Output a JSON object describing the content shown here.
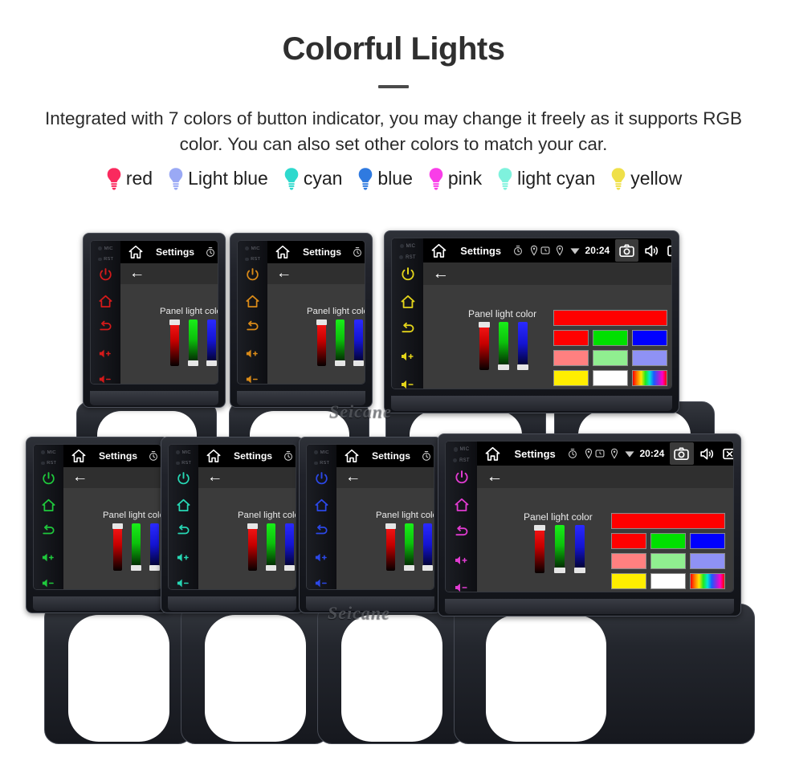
{
  "header": {
    "title": "Colorful Lights",
    "subtitle": "Integrated with 7 colors of button indicator, you may change it freely as it supports RGB color. You can also set other colors to match your car."
  },
  "legend": {
    "items": [
      {
        "label": "red",
        "color": "#fa2a5e",
        "icon": "bulb-icon"
      },
      {
        "label": "Light blue",
        "color": "#9aa9f5",
        "icon": "bulb-icon"
      },
      {
        "label": "cyan",
        "color": "#2ed9cd",
        "icon": "bulb-icon"
      },
      {
        "label": "blue",
        "color": "#2f7ae0",
        "icon": "bulb-icon"
      },
      {
        "label": "pink",
        "color": "#f93ee8",
        "icon": "bulb-icon"
      },
      {
        "label": "light cyan",
        "color": "#7ff2dd",
        "icon": "bulb-icon"
      },
      {
        "label": "yellow",
        "color": "#efe049",
        "icon": "bulb-icon"
      }
    ]
  },
  "screen_ui": {
    "status_title": "Settings",
    "clock": "20:24",
    "back_arrow": "←",
    "panel_label": "Panel light color",
    "status_icons": {
      "home": "home-icon",
      "timer": "timer-icon",
      "gps": "gps-icon",
      "alarm": "alarm-icon",
      "location": "location-icon",
      "wifi": "wifi-icon",
      "camera": "camera-icon",
      "volume": "volume-icon",
      "close": "close-icon",
      "recents": "recents-icon",
      "back": "back-icon"
    },
    "sliders": [
      {
        "name": "red",
        "value": 100
      },
      {
        "name": "green",
        "value": 0
      },
      {
        "name": "blue",
        "value": 0
      }
    ],
    "preview_color": "#ff0000",
    "swatch_rows": [
      [
        "#ff0000",
        "#00e000",
        "#0000ff"
      ],
      [
        "#ff8080",
        "#90ee90",
        "#8f92f5"
      ],
      [
        "#ffee00",
        "#ffffff",
        "rainbow"
      ]
    ]
  },
  "rail": {
    "labels": [
      "MIC",
      "RST"
    ],
    "buttons": [
      "power-icon",
      "home-icon",
      "back-icon",
      "volume-up-icon",
      "volume-down-icon"
    ]
  },
  "units": [
    {
      "id": "unit-red",
      "led_color": "#d41a1a",
      "show_swatches": false
    },
    {
      "id": "unit-orange",
      "led_color": "#d98a18",
      "show_swatches": false
    },
    {
      "id": "unit-yellow",
      "led_color": "#e3d41a",
      "show_swatches": true
    },
    {
      "id": "unit-green",
      "led_color": "#1fc93c",
      "show_swatches": false
    },
    {
      "id": "unit-light-cyan",
      "led_color": "#27d7b4",
      "show_swatches": false
    },
    {
      "id": "unit-blue",
      "led_color": "#2b48e8",
      "show_swatches": false
    },
    {
      "id": "unit-pink",
      "led_color": "#e03bd0",
      "show_swatches": true
    }
  ],
  "watermark": {
    "text": "Seicane"
  }
}
